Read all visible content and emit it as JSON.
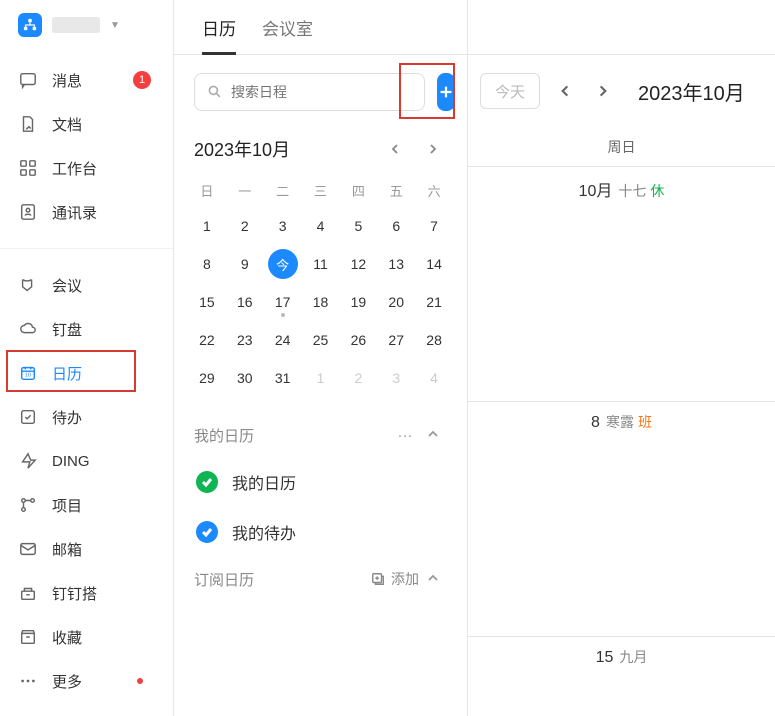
{
  "sidebar": {
    "items": [
      {
        "label": "消息",
        "badge": "1",
        "icon": "message"
      },
      {
        "label": "文档",
        "icon": "doc"
      },
      {
        "label": "工作台",
        "icon": "apps"
      },
      {
        "label": "通讯录",
        "icon": "contacts"
      },
      {
        "label": "会议",
        "icon": "meeting"
      },
      {
        "label": "钉盘",
        "icon": "cloud"
      },
      {
        "label": "日历",
        "icon": "calendar",
        "active": true
      },
      {
        "label": "待办",
        "icon": "todo"
      },
      {
        "label": "DING",
        "icon": "ding"
      },
      {
        "label": "项目",
        "icon": "project"
      },
      {
        "label": "邮箱",
        "icon": "mail"
      },
      {
        "label": "钉钉搭",
        "icon": "build"
      },
      {
        "label": "收藏",
        "icon": "fav"
      },
      {
        "label": "更多",
        "icon": "more",
        "dot": true
      }
    ]
  },
  "tabs": {
    "calendar": "日历",
    "rooms": "会议室"
  },
  "search": {
    "placeholder": "搜索日程"
  },
  "miniCalendar": {
    "title": "2023年10月",
    "dow": [
      "日",
      "一",
      "二",
      "三",
      "四",
      "五",
      "六"
    ],
    "todayLabel": "今",
    "weeks": [
      [
        "1",
        "2",
        "3",
        "4",
        "5",
        "6",
        "7"
      ],
      [
        "8",
        "9",
        "今",
        "11",
        "12",
        "13",
        "14"
      ],
      [
        "15",
        "16",
        "17",
        "18",
        "19",
        "20",
        "21"
      ],
      [
        "22",
        "23",
        "24",
        "25",
        "26",
        "27",
        "28"
      ],
      [
        "29",
        "30",
        "31",
        "1",
        "2",
        "3",
        "4"
      ]
    ]
  },
  "myCalendars": {
    "title": "我的日历",
    "items": [
      {
        "label": "我的日历",
        "color": "green"
      },
      {
        "label": "我的待办",
        "color": "blue"
      }
    ]
  },
  "subscribed": {
    "title": "订阅日历",
    "addLabel": "添加"
  },
  "rightPanel": {
    "todayBtn": "今天",
    "title": "2023年10月",
    "dowHeader": "周日",
    "days": [
      {
        "prefix": "10月",
        "lunar": "十七",
        "tag": "休",
        "tagType": "rest"
      },
      {
        "prefix": "8",
        "lunar": "寒露",
        "tag": "班",
        "tagType": "work"
      },
      {
        "prefix": "15",
        "lunar": "九月",
        "tag": "",
        "tagType": ""
      }
    ]
  }
}
